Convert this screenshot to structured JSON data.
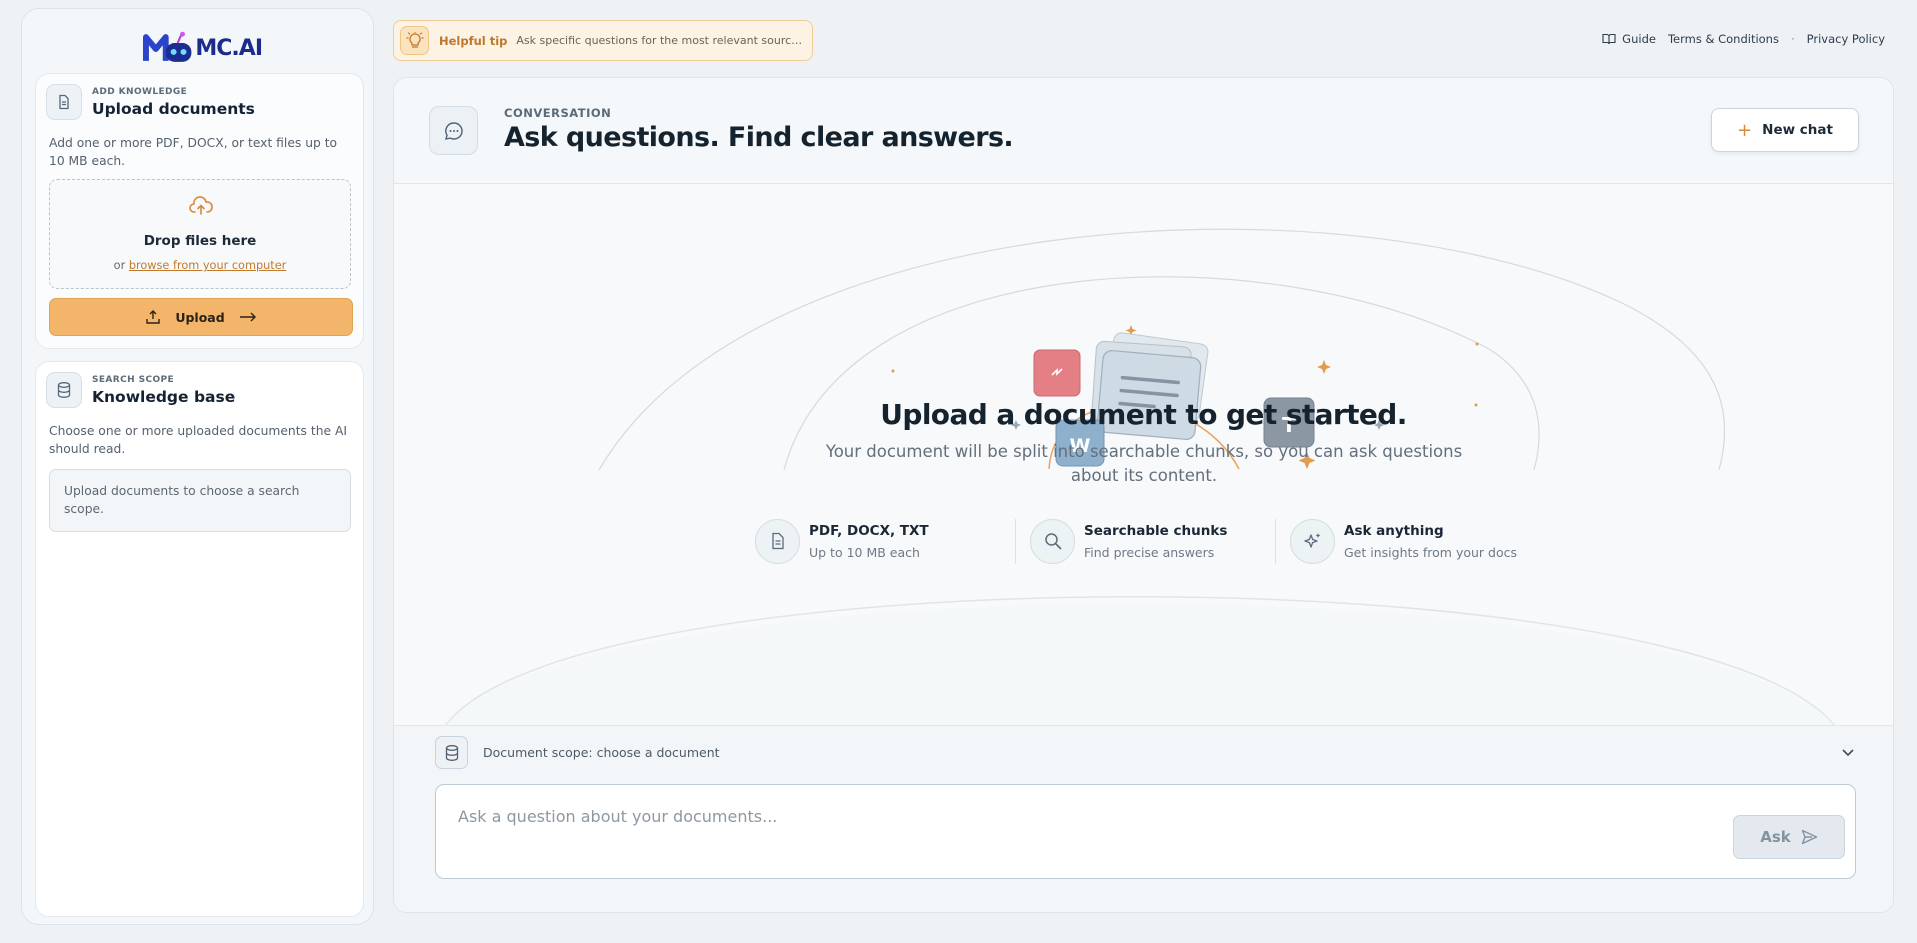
{
  "logo": {
    "text": "MC.AI"
  },
  "sidebar": {
    "upload_card": {
      "eyebrow": "ADD KNOWLEDGE",
      "title": "Upload documents",
      "description": "Add one or more PDF, DOCX, or text files up to 10 MB each.",
      "drop_title": "Drop files here",
      "drop_prefix": "or",
      "drop_link": "browse from your computer",
      "upload_label": "Upload",
      "icon": "document-icon"
    },
    "scope_card": {
      "eyebrow": "SEARCH SCOPE",
      "title": "Knowledge base",
      "description": "Choose one or more uploaded documents the AI should read.",
      "empty_text": "Upload documents to choose a search scope.",
      "icon": "database-icon"
    }
  },
  "topbar": {
    "tip_label": "Helpful tip",
    "tip_text": "Ask specific questions for the most relevant source passages",
    "links": {
      "guide": "Guide",
      "terms": "Terms & Conditions",
      "separator": "·",
      "privacy": "Privacy Policy"
    }
  },
  "main": {
    "eyebrow": "CONVERSATION",
    "title": "Ask questions. Find clear answers.",
    "new_chat": "New chat",
    "illustration": {
      "word_tile": "W",
      "text_tile": "T"
    },
    "hero_title": "Upload a document to get started.",
    "hero_sub": "Your document will be split into searchable chunks, so you can ask questions about its content.",
    "features": [
      {
        "title": "PDF, DOCX, TXT",
        "sub": "Up to 10 MB each",
        "icon": "file-icon"
      },
      {
        "title": "Searchable chunks",
        "sub": "Find precise answers",
        "icon": "search-icon"
      },
      {
        "title": "Ask anything",
        "sub": "Get insights from your docs",
        "icon": "sparkle-icon"
      }
    ]
  },
  "composer": {
    "scope_text": "Document scope: choose a document",
    "placeholder": "Ask a question about your documents...",
    "ask_label": "Ask"
  },
  "colors": {
    "accent": "#f3b569",
    "accent_text": "#c17a2c",
    "ink": "#15232f"
  }
}
